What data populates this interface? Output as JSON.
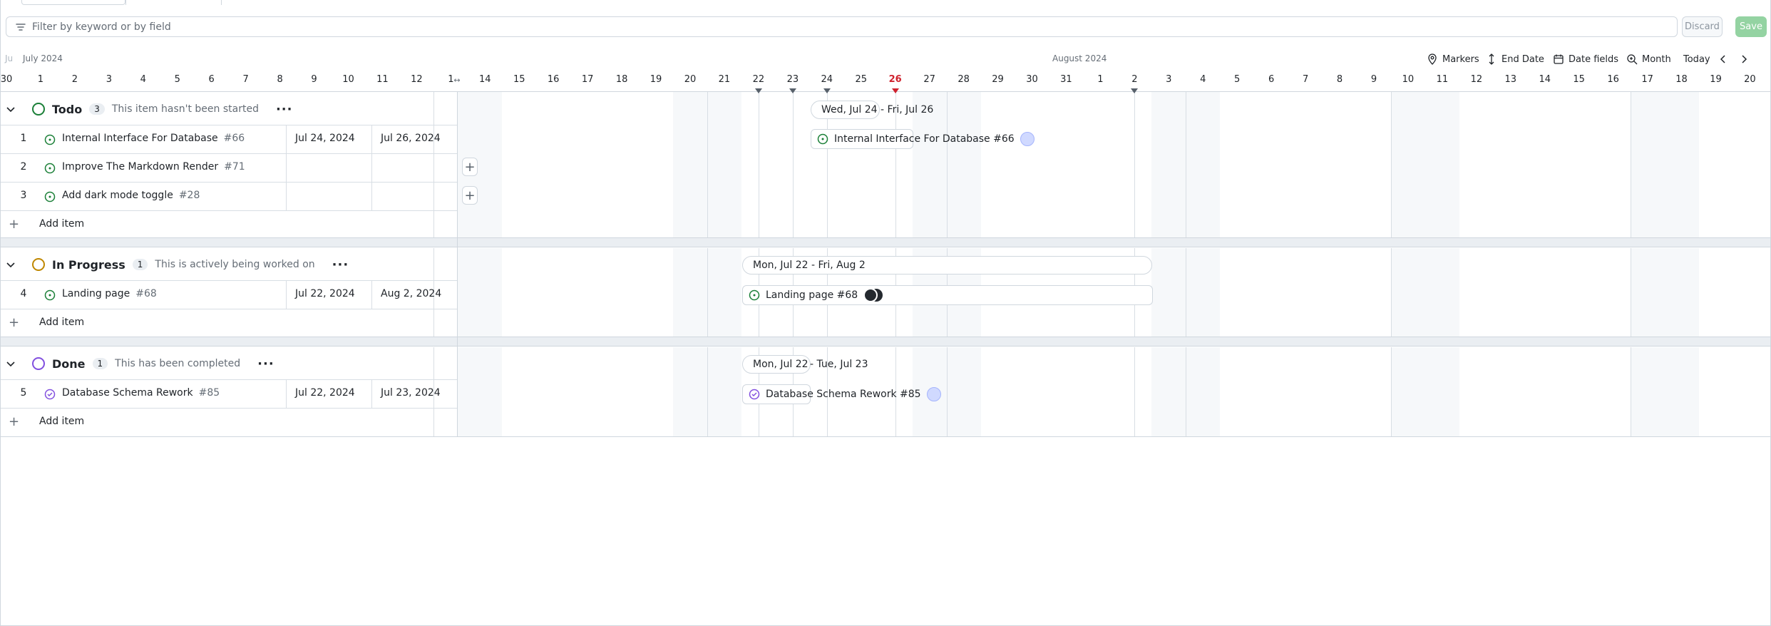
{
  "filter": {
    "placeholder": "Filter by keyword or by field",
    "discard_label": "Discard",
    "save_label": "Save"
  },
  "timeline": {
    "prev_month_label": "Ju",
    "month_left": "July 2024",
    "month_right": "August 2024",
    "controls": {
      "markers": "Markers",
      "end_date": "End Date",
      "date_fields": "Date fields",
      "zoom": "Month",
      "today": "Today"
    },
    "days": [
      "30",
      "1",
      "2",
      "3",
      "4",
      "5",
      "6",
      "7",
      "8",
      "9",
      "10",
      "11",
      "12",
      "1",
      "14",
      "15",
      "16",
      "17",
      "18",
      "19",
      "20",
      "21",
      "22",
      "23",
      "24",
      "25",
      "26",
      "27",
      "28",
      "29",
      "30",
      "31",
      "1",
      "2",
      "3",
      "4",
      "5",
      "6",
      "7",
      "8",
      "9",
      "10",
      "11",
      "12",
      "13",
      "14",
      "15",
      "16",
      "17",
      "18",
      "19",
      "20"
    ],
    "today": "26"
  },
  "groups": [
    {
      "name": "Todo",
      "count": "3",
      "description": "This item hasn't been started",
      "color": "#1a7f37",
      "more": "···",
      "items": [
        {
          "num": "1",
          "title": "Internal Interface For Database",
          "issue": "#66",
          "start": "Jul 24, 2024",
          "end": "Jul 26, 2024"
        },
        {
          "num": "2",
          "title": "Improve The Markdown Render",
          "issue": "#71",
          "start": "",
          "end": ""
        },
        {
          "num": "3",
          "title": "Add dark mode toggle",
          "issue": "#28",
          "start": "",
          "end": ""
        }
      ],
      "add_label": "Add item",
      "range_label": "Wed, Jul 24 - Fri, Jul 26"
    },
    {
      "name": "In Progress",
      "count": "1",
      "description": "This is actively being worked on",
      "color": "#bf8700",
      "more": "···",
      "items": [
        {
          "num": "4",
          "title": "Landing page",
          "issue": "#68",
          "start": "Jul 22, 2024",
          "end": "Aug 2, 2024"
        }
      ],
      "add_label": "Add item",
      "range_label": "Mon, Jul 22 - Fri, Aug 2"
    },
    {
      "name": "Done",
      "count": "1",
      "description": "This has been completed",
      "color": "#8250df",
      "more": "···",
      "items": [
        {
          "num": "5",
          "title": "Database Schema Rework",
          "issue": "#85",
          "start": "Jul 22, 2024",
          "end": "Jul 23, 2024"
        }
      ],
      "add_label": "Add item",
      "range_label_a": "Mon, Jul 22",
      "range_label_b": "- Tue, Jul 23"
    }
  ],
  "bars": {
    "b66": "Internal Interface For Database #66",
    "b68": "Landing page #68",
    "b85": "Database Schema Rework #85"
  }
}
